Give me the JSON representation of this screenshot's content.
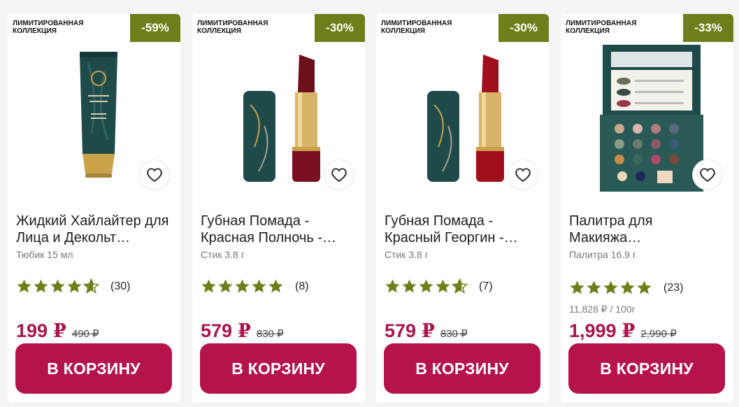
{
  "products": [
    {
      "collection_badge": "ЛИМИТИРОВАННАЯ КОЛЛЕКЦИЯ",
      "discount": "-59%",
      "image_icon": "highlighter-tube-image",
      "title": "Жидкий Хайлайтер для Лица и Декольт…",
      "variant": "Тюбик  15 мл",
      "rating": 5,
      "review_count": "(30)",
      "unit_price": "",
      "price": "199",
      "currency": "₽",
      "old_price": "490 ₽",
      "cart_label": "В КОРЗИНУ"
    },
    {
      "collection_badge": "ЛИМИТИРОВАННАЯ КОЛЛЕКЦИЯ",
      "discount": "-30%",
      "image_icon": "lipstick-image",
      "title": "Губная Помада - Красная Полночь -…",
      "variant": "Стик  3.8 г",
      "rating": 5,
      "review_count": "(8)",
      "unit_price": "",
      "price": "579",
      "currency": "₽",
      "old_price": "830 ₽",
      "cart_label": "В КОРЗИНУ"
    },
    {
      "collection_badge": "ЛИМИТИРОВАННАЯ КОЛЛЕКЦИЯ",
      "discount": "-30%",
      "image_icon": "lipstick-image",
      "title": "Губная Помада - Красный Георгин -…",
      "variant": "Стик  3.8 г",
      "rating": 5,
      "review_count": "(7)",
      "unit_price": "",
      "price": "579",
      "currency": "₽",
      "old_price": "830 ₽",
      "cart_label": "В КОРЗИНУ"
    },
    {
      "collection_badge": "ЛИМИТИРОВАННАЯ КОЛЛЕКЦИЯ",
      "discount": "-33%",
      "image_icon": "eyeshadow-palette-image",
      "title": "Палитра для Макияжа…",
      "variant": "Палитра  16.9 г",
      "rating": 5,
      "review_count": "(23)",
      "unit_price": "11,828 ₽ / 100г",
      "price": "1,999",
      "currency": "₽",
      "old_price": "2,990 ₽",
      "cart_label": "В КОРЗИНУ"
    }
  ],
  "colors": {
    "accent": "#b5134e",
    "price": "#a8164d",
    "discount_bg": "#6f7e1a",
    "star": "#6f7e1a",
    "packaging": "#1f4a4a",
    "gold": "#c9a24a",
    "lipstick_dark": "#7a1020",
    "lipstick_red": "#a0101c"
  }
}
